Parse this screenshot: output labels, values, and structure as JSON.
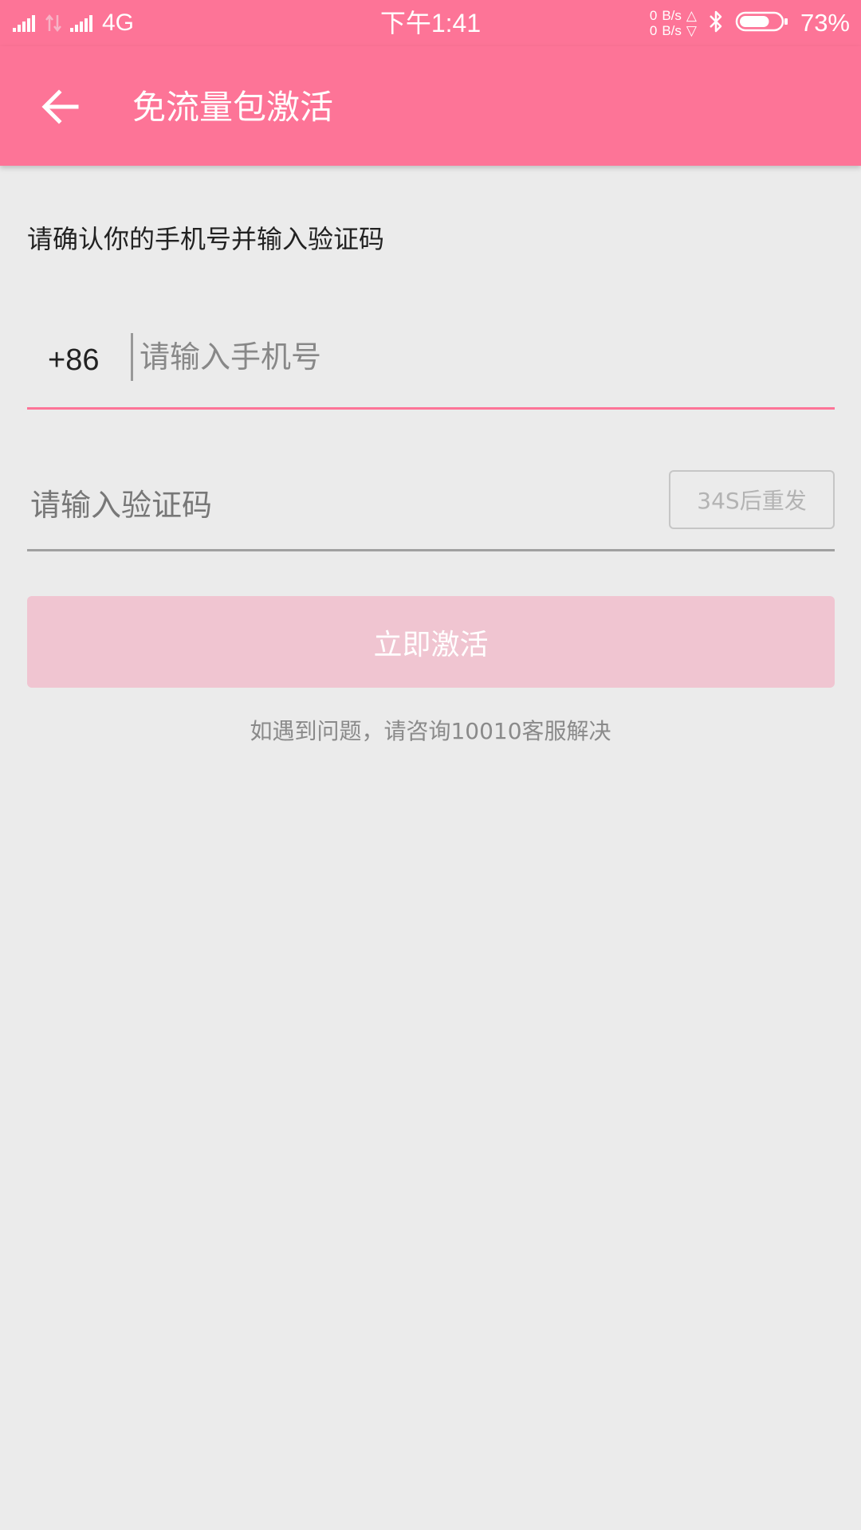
{
  "status_bar": {
    "network_type": "4G",
    "time": "下午1:41",
    "upload_speed_value": "0",
    "upload_speed_unit": "B/s",
    "download_speed_value": "0",
    "download_speed_unit": "B/s",
    "battery_percent": "73%",
    "battery_level": 0.73,
    "icons": [
      "signal-icon",
      "data-transfer-icon",
      "signal-icon",
      "upload-arrow-icon",
      "download-arrow-icon",
      "bluetooth-icon",
      "battery-icon"
    ]
  },
  "app_bar": {
    "title": "免流量包激活",
    "back_icon": "back-arrow-icon"
  },
  "form": {
    "instruction": "请确认你的手机号并输入验证码",
    "country_code": "+86",
    "phone_placeholder": "请输入手机号",
    "code_placeholder": "请输入验证码",
    "resend_label": "34S后重发",
    "activate_label": "立即激活",
    "help_text": "如遇到问题，请咨询10010客服解决"
  },
  "colors": {
    "accent": "#fd7497",
    "background": "#ebebeb",
    "activate_disabled": "#f0c5d1",
    "text_dark": "#222222",
    "text_hint": "#888888"
  }
}
